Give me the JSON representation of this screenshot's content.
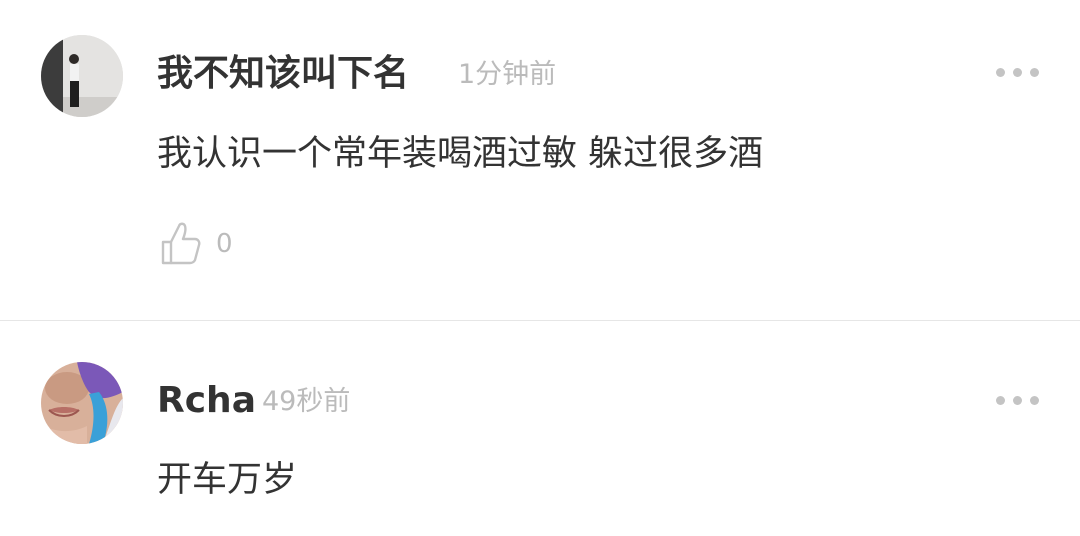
{
  "comments": [
    {
      "username": "我不知该叫下名",
      "time": "1分钟前",
      "text": "我认识一个常年装喝酒过敏 躲过很多酒",
      "like_count": "0",
      "avatar_icon": "avatar-photo-person-in-room",
      "more_icon": "more-options-icon"
    },
    {
      "username": "Rcha",
      "time": "49秒前",
      "text": "开车万岁",
      "avatar_icon": "avatar-photo-face-closeup",
      "more_icon": "more-options-icon"
    }
  ],
  "colors": {
    "username": "#333333",
    "text": "#333333",
    "meta": "#bbbbbb",
    "divider": "#e6e6e6",
    "icon": "#c4c4c4"
  }
}
